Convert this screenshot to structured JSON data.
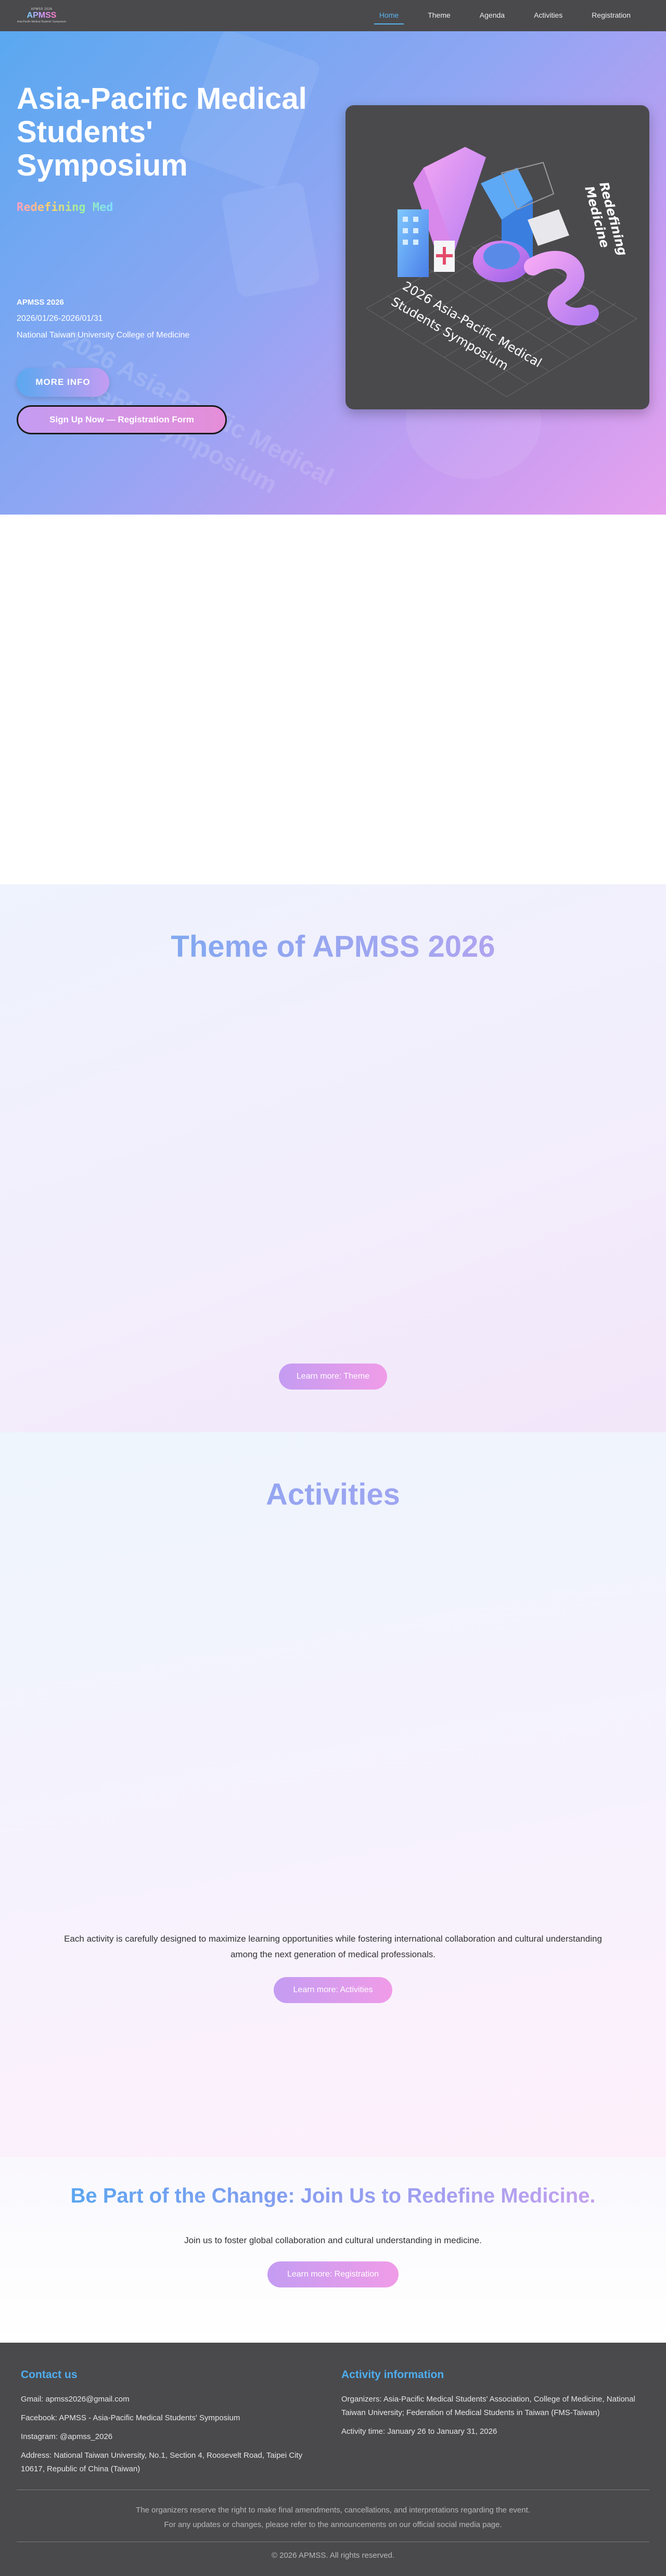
{
  "nav": {
    "logo": {
      "top": "APMSS 2026",
      "mark": "APMSS",
      "bottom": "Asia-Pacific Medical Students' Symposium"
    },
    "links": [
      {
        "label": "Home",
        "active": true
      },
      {
        "label": "Theme",
        "active": false
      },
      {
        "label": "Agenda",
        "active": false
      },
      {
        "label": "Activities",
        "active": false
      },
      {
        "label": "Registration",
        "active": false
      }
    ]
  },
  "hero": {
    "title": "Asia-Pacific Medical Students' Symposium",
    "subtitle": "Redefining Med",
    "event_name": "APMSS 2026",
    "dates": "2026/01/26-2026/01/31",
    "venue": "National Taiwan University College of Medicine",
    "more_button": "MORE INFO",
    "signup_button": "Sign Up Now — Registration Form",
    "art": {
      "tagline_line1": "Redefining",
      "tagline_line2": "Medicine",
      "caption_line1": "2026 Asia-Pacific Medical",
      "caption_line2": "Students Symposium"
    }
  },
  "theme": {
    "title": "Theme of APMSS 2026",
    "button": "Learn more: Theme"
  },
  "activities": {
    "title": "Activities",
    "description": "Each activity is carefully designed to maximize learning opportunities while fostering international collaboration and cultural understanding among the next generation of medical professionals.",
    "button": "Learn more: Activities"
  },
  "join": {
    "title": "Be Part of the Change: Join Us to Redefine Medicine.",
    "subtitle": "Join us to foster global collaboration and cultural understanding in medicine.",
    "button": "Learn more: Registration"
  },
  "footer": {
    "contact_heading": "Contact us",
    "gmail": "Gmail: apmss2026@gmail.com",
    "facebook": "Facebook: APMSS - Asia-Pacific Medical Students' Symposium",
    "instagram": "Instagram: @apmss_2026",
    "address": "Address: National Taiwan University, No.1, Section 4, Roosevelt Road, Taipei City 10617, Republic of China (Taiwan)",
    "info_heading": "Activity information",
    "organizers": "Organizers: Asia-Pacific Medical Students' Association, College of Medicine, National Taiwan University; Federation of Medical Students in Taiwan (FMS-Taiwan)",
    "activity_time": "Activity time: January 26 to January 31, 2026",
    "note_line1": "The organizers reserve the right to make final amendments, cancellations, and interpretations regarding the event.",
    "note_line2": "For any updates or changes, please refer to the announcements on our official social media page.",
    "copyright": "© 2026 APMSS. All rights reserved."
  }
}
